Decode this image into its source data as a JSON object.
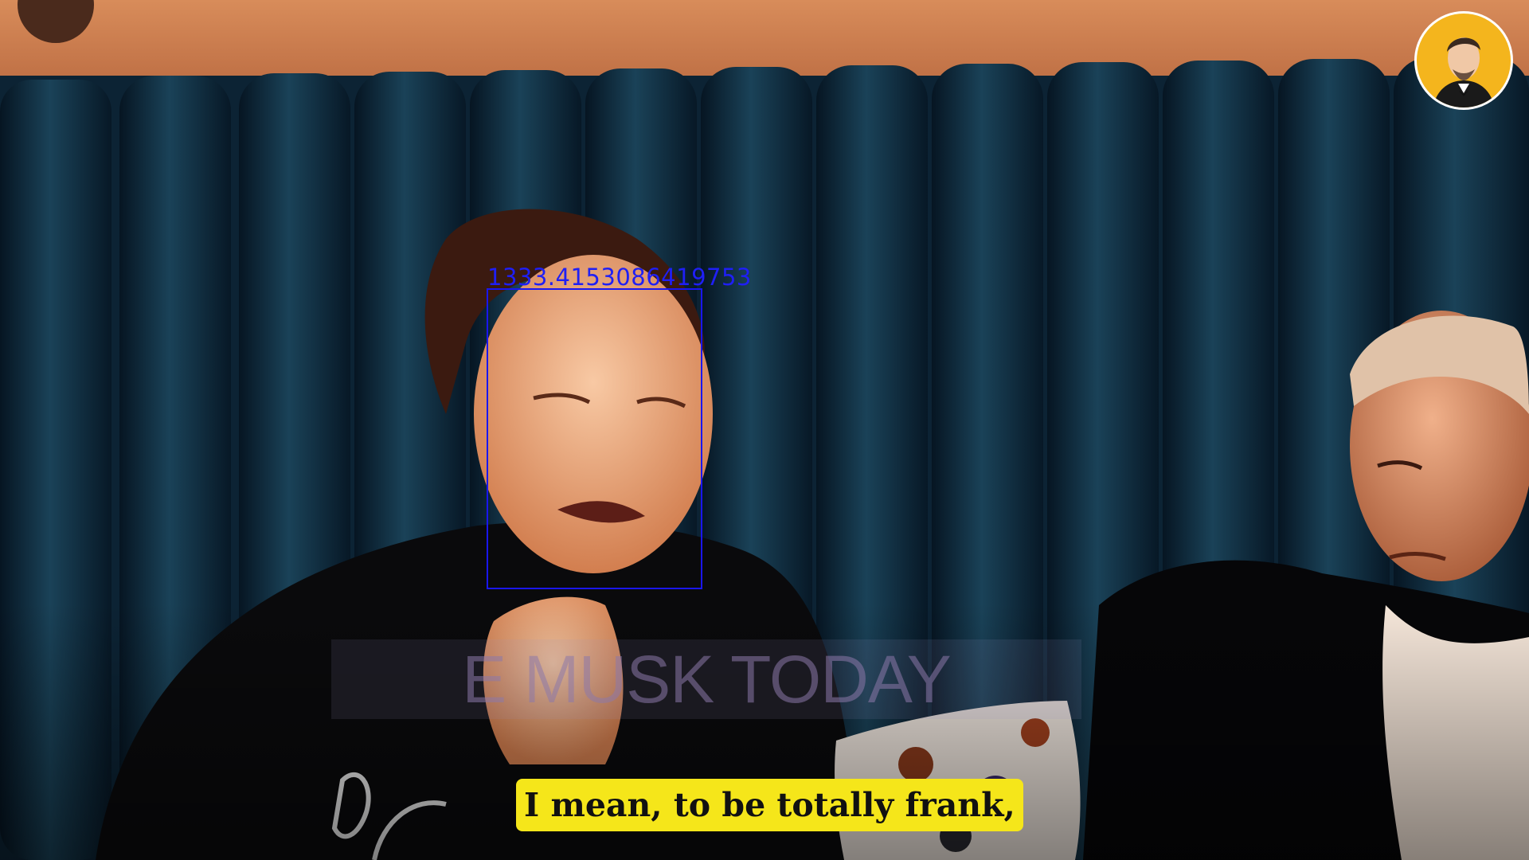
{
  "colors": {
    "detection_box": "#1a16f0",
    "caption_background": "#f5e61a",
    "caption_text": "#111111",
    "avatar_background": "#f4b51d",
    "couch": "#0f2a3e"
  },
  "overlay": {
    "detection_score": "1333.4153086419753"
  },
  "watermark": {
    "text": "E   MUSK TODAY"
  },
  "caption": {
    "text": "I mean, to be totally frank,"
  },
  "channel": {
    "avatar_icon": "portrait-avatar-icon"
  }
}
